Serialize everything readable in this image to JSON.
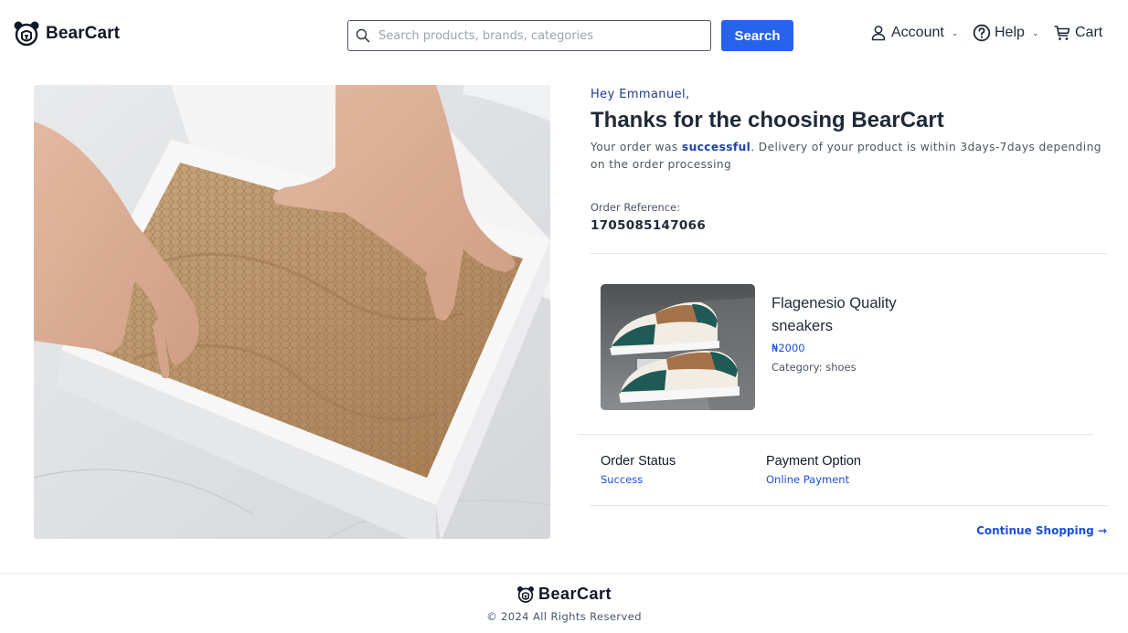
{
  "header": {
    "brand": "BearCart",
    "search": {
      "placeholder": "Search products, brands, categories",
      "value": "",
      "button_label": "Search"
    },
    "nav": {
      "account": "Account",
      "help": "Help",
      "cart": "Cart"
    }
  },
  "confirmation": {
    "greeting": "Hey Emmanuel,",
    "title": "Thanks for the choosing BearCart",
    "message_prefix": "Your order was ",
    "message_status": "successful",
    "message_suffix": ". Delivery of your product is within 3days-7days depending on the order processing",
    "order_reference_label": "Order Reference:",
    "order_reference": "1705085147066"
  },
  "product": {
    "name": "Flagenesio Quality sneakers",
    "price": "₦2000",
    "category": "Category: shoes"
  },
  "order_meta": {
    "status_label": "Order Status",
    "status_value": "Success",
    "payment_label": "Payment Option",
    "payment_value": "Online Payment"
  },
  "continue_label": "Continue Shopping →",
  "footer": {
    "brand": "BearCart",
    "copyright": "© 2024 All Rights Reserved"
  },
  "icons": {
    "logo": "bear-logo-icon",
    "search": "search-icon",
    "account": "user-icon",
    "help": "help-circle-icon",
    "cart": "cart-icon",
    "chevron": "chevron-down-icon"
  },
  "colors": {
    "accent": "#2563eb",
    "link": "#1d4ed8",
    "text": "#1f2937"
  }
}
